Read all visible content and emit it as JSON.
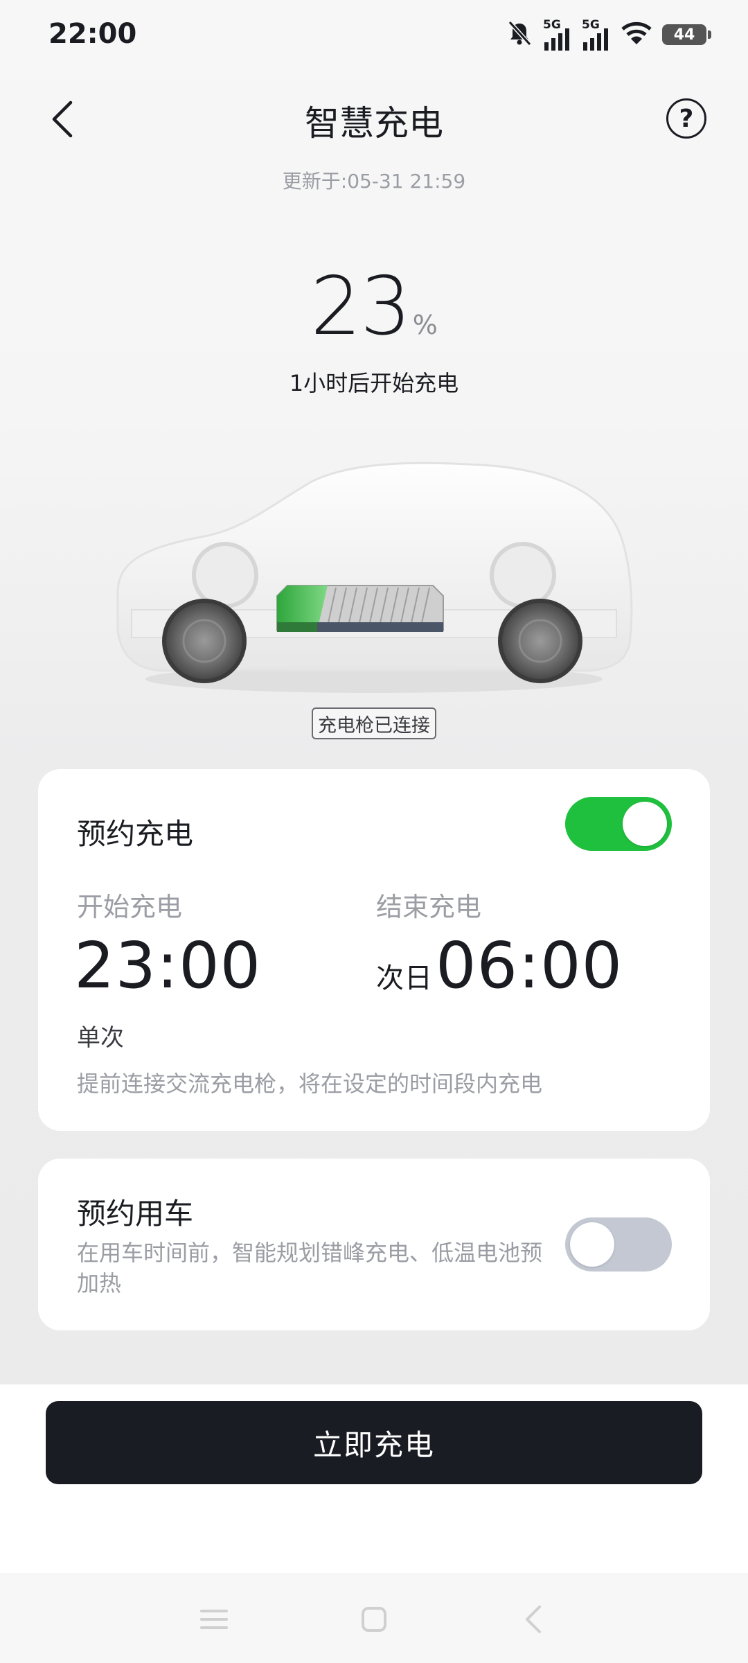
{
  "status_bar": {
    "time": "22:00",
    "signal1_label": "5G",
    "signal2_label": "5G",
    "battery": "44"
  },
  "header": {
    "title": "智慧充电",
    "update_time": "更新于:05-31 21:59"
  },
  "vehicle": {
    "soc_value": "23",
    "soc_unit": "%",
    "charge_hint": "1小时后开始充电",
    "gun_status": "充电枪已连接",
    "battery_level": 0.23
  },
  "scheduled_charging": {
    "title": "预约充电",
    "enabled": true,
    "start_label": "开始充电",
    "start_time": "23:00",
    "end_label": "结束充电",
    "end_prefix": "次日",
    "end_time": "06:00",
    "repeat": "单次",
    "hint": "提前连接交流充电枪，将在设定的时间段内充电"
  },
  "scheduled_usage": {
    "title": "预约用车",
    "enabled": false,
    "description": "在用车时间前，智能规划错峰充电、低温电池预加热"
  },
  "actions": {
    "charge_now": "立即充电"
  },
  "colors": {
    "toggle_on": "#1fc03d",
    "toggle_off": "#c3c8d3",
    "primary_button": "#1a1c24"
  }
}
